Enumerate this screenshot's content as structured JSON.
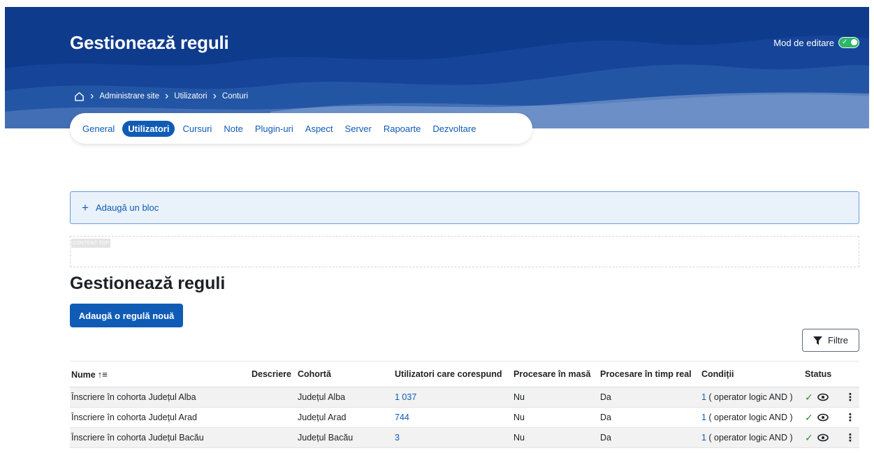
{
  "header": {
    "title": "Gestionează reguli",
    "edit_mode_label": "Mod de editare",
    "edit_mode_on": true
  },
  "breadcrumb": {
    "home_icon": "home-icon",
    "items": [
      "Administrare site",
      "Utilizatori",
      "Conturi"
    ]
  },
  "tabs": [
    {
      "label": "General",
      "active": false
    },
    {
      "label": "Utilizatori",
      "active": true
    },
    {
      "label": "Cursuri",
      "active": false
    },
    {
      "label": "Note",
      "active": false
    },
    {
      "label": "Plugin-uri",
      "active": false
    },
    {
      "label": "Aspect",
      "active": false
    },
    {
      "label": "Server",
      "active": false
    },
    {
      "label": "Rapoarte",
      "active": false
    },
    {
      "label": "Dezvoltare",
      "active": false
    }
  ],
  "add_block": {
    "label": "Adaugă un bloc",
    "icon": "plus-icon"
  },
  "region": {
    "label": "CONTENT-TOP"
  },
  "main": {
    "title": "Gestionează reguli",
    "add_rule_label": "Adaugă o regulă nouă",
    "filter_label": "Filtre"
  },
  "table": {
    "headers": {
      "name": "Nume",
      "description": "Descriere",
      "cohort": "Cohortă",
      "matching_users": "Utilizatori care corespund",
      "bulk_processing": "Procesare în masă",
      "realtime_processing": "Procesare în timp real",
      "conditions": "Condiții",
      "status": "Status"
    },
    "rows": [
      {
        "name": "Înscriere în cohorta Județul Alba",
        "description": "",
        "cohort": "Județul Alba",
        "users": "1 037",
        "bulk": "Nu",
        "realtime": "Da",
        "cond_count": "1",
        "cond_text": " ( operator logic AND )"
      },
      {
        "name": "Înscriere în cohorta Județul Arad",
        "description": "",
        "cohort": "Județul Arad",
        "users": "744",
        "bulk": "Nu",
        "realtime": "Da",
        "cond_count": "1",
        "cond_text": " ( operator logic AND )"
      },
      {
        "name": "Înscriere în cohorta Județul Bacău",
        "description": "",
        "cohort": "Județul Bacău",
        "users": "3",
        "bulk": "Nu",
        "realtime": "Da",
        "cond_count": "1",
        "cond_text": " ( operator logic AND )"
      }
    ]
  },
  "colors": {
    "hero_bg": "#0f3b8c",
    "accent": "#0f5bb5",
    "toggle_on": "#2fb56a"
  }
}
